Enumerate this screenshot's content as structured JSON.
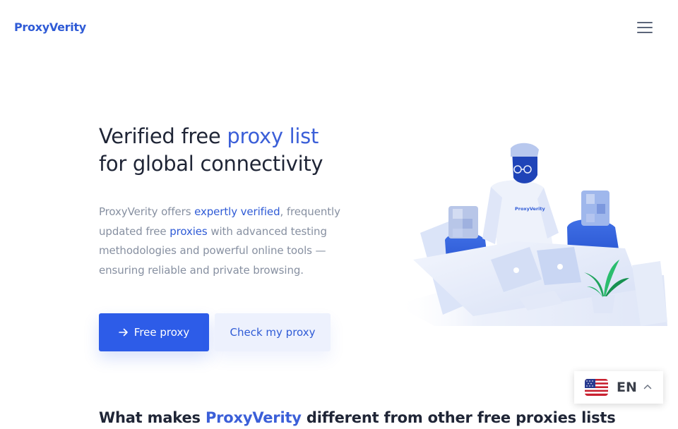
{
  "header": {
    "logo": "ProxyVerity",
    "menu_icon": "hamburger-icon"
  },
  "hero": {
    "title_part1": "Verified free ",
    "title_highlight": "proxy list",
    "title_line2": "for global connectivity",
    "desc_part1": "ProxyVerity offers ",
    "desc_link1": "expertly verified",
    "desc_part2": ", frequently updated free ",
    "desc_link2": "proxies",
    "desc_part3": " with advanced testing methodologies and powerful online tools — ensuring reliable and private browsing.",
    "primary_button": "Free proxy",
    "primary_button_icon": "arrow-right-icon",
    "secondary_button": "Check my proxy",
    "illustration_shirt_text": "ProxyVerity"
  },
  "section": {
    "title_part1": "What makes ",
    "title_highlight": "ProxyVerity",
    "title_part2": " different from other free proxies lists"
  },
  "language": {
    "code": "EN",
    "flag_icon": "us-flag-icon",
    "chevron_icon": "chevron-up-icon"
  },
  "colors": {
    "accent": "#2f5bd6",
    "primary_button": "#2d5ce8",
    "secondary_button_bg": "#edf1fd",
    "text_dark": "#1f2536",
    "text_muted": "#8790a1"
  }
}
